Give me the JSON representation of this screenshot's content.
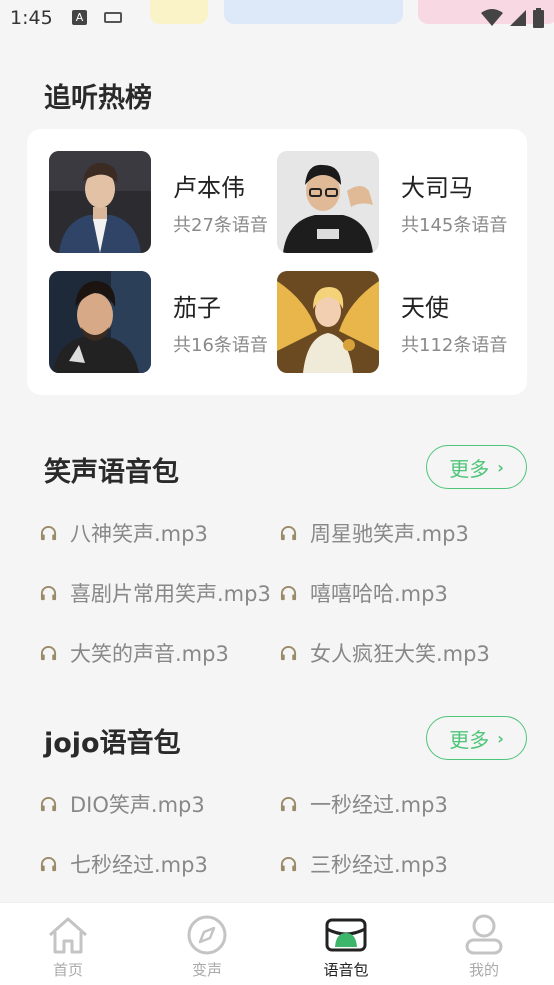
{
  "status_bar": {
    "time": "1:45",
    "keyboard_letter": "A"
  },
  "hot_section": {
    "title": "追听热榜",
    "items": [
      {
        "name": "卢本伟",
        "count": "共27条语音"
      },
      {
        "name": "大司马",
        "count": "共145条语音"
      },
      {
        "name": "茄子",
        "count": "共16条语音"
      },
      {
        "name": "天使",
        "count": "共112条语音"
      }
    ]
  },
  "laugh_pack": {
    "title": "笑声语音包",
    "more_label": "更多",
    "items": [
      "八神笑声.mp3",
      "周星驰笑声.mp3",
      "喜剧片常用笑声.mp3",
      "嘻嘻哈哈.mp3",
      "大笑的声音.mp3",
      "女人疯狂大笑.mp3"
    ]
  },
  "jojo_pack": {
    "title": "jojo语音包",
    "more_label": "更多",
    "items": [
      "DIO笑声.mp3",
      "一秒经过.mp3",
      "七秒经过.mp3",
      "三秒经过.mp3"
    ]
  },
  "bottom_nav": {
    "items": [
      {
        "label": "首页",
        "icon": "home-icon"
      },
      {
        "label": "变声",
        "icon": "compass-icon"
      },
      {
        "label": "语音包",
        "icon": "voice-pack-icon"
      },
      {
        "label": "我的",
        "icon": "profile-icon"
      }
    ],
    "active_index": 2
  },
  "colors": {
    "accent": "#4fc57a",
    "muted_text": "#888888",
    "background": "#f5f5f5"
  }
}
